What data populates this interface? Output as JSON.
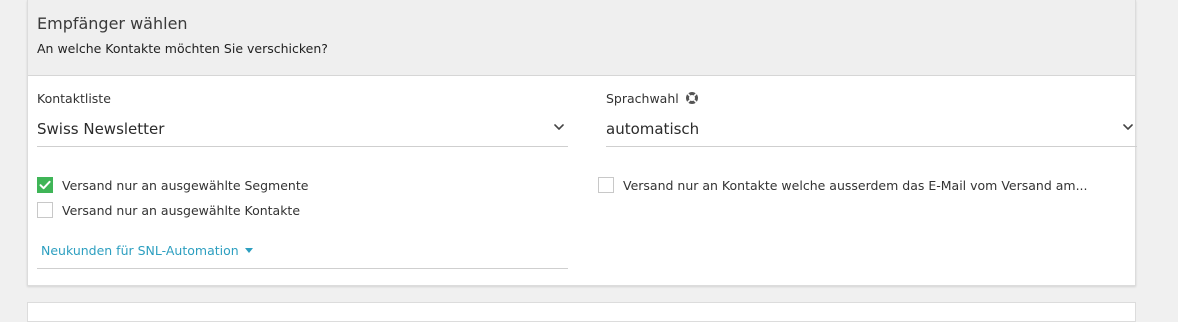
{
  "header": {
    "title": "Empfänger wählen",
    "subtitle": "An welche Kontakte möchten Sie verschicken?"
  },
  "contact_list": {
    "label": "Kontaktliste",
    "selected": "Swiss Newsletter"
  },
  "language": {
    "label": "Sprachwahl",
    "selected": "automatisch",
    "help_icon": "lifebuoy-icon"
  },
  "options": {
    "segments": {
      "label": "Versand nur an ausgewählte Segmente",
      "checked": true
    },
    "contacts": {
      "label": "Versand nur an ausgewählte Kontakte",
      "checked": false
    },
    "also_received": {
      "label": "Versand nur an Kontakte welche ausserdem das E-Mail vom Versand am...",
      "checked": false
    }
  },
  "segment_selector": {
    "label": "Neukunden für SNL-Automation"
  },
  "colors": {
    "accent_green": "#3fb557",
    "link_blue": "#2d9fc0",
    "header_bg": "#efefef"
  }
}
